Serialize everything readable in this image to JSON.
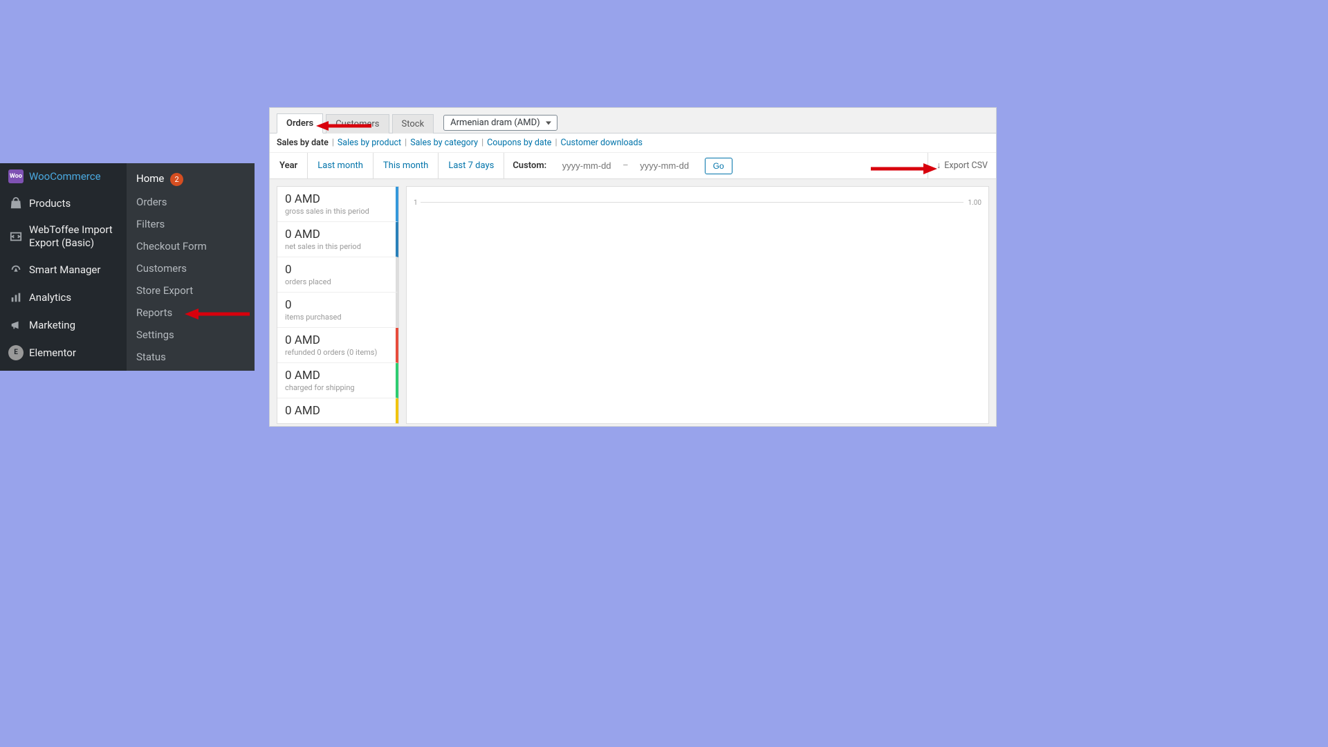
{
  "sidebar": {
    "main": [
      {
        "label": "WooCommerce",
        "icon": "woo"
      },
      {
        "label": "Products",
        "icon": "bag"
      },
      {
        "label": "WebToffee Import Export (Basic)",
        "icon": "import-export"
      },
      {
        "label": "Smart Manager",
        "icon": "gauge"
      },
      {
        "label": "Analytics",
        "icon": "bars"
      },
      {
        "label": "Marketing",
        "icon": "megaphone"
      },
      {
        "label": "Elementor",
        "icon": "elementor"
      }
    ],
    "submenu": {
      "home": {
        "label": "Home",
        "badge": "2"
      },
      "items": [
        {
          "label": "Orders"
        },
        {
          "label": "Filters"
        },
        {
          "label": "Checkout Form"
        },
        {
          "label": "Customers"
        },
        {
          "label": "Store Export"
        },
        {
          "label": "Reports"
        },
        {
          "label": "Settings"
        },
        {
          "label": "Status"
        }
      ]
    }
  },
  "reports": {
    "tabs": [
      {
        "label": "Orders",
        "active": true
      },
      {
        "label": "Customers"
      },
      {
        "label": "Stock"
      }
    ],
    "currency": "Armenian dram (AMD)",
    "sub_filters": {
      "active": "Sales by date",
      "links": [
        "Sales by product",
        "Sales by category",
        "Coupons by date",
        "Customer downloads"
      ]
    },
    "ranges": {
      "items": [
        "Year",
        "Last month",
        "This month",
        "Last 7 days"
      ],
      "active": "Year",
      "custom_label": "Custom:",
      "placeholder": "yyyy-mm-dd",
      "go": "Go"
    },
    "export_label": "Export CSV",
    "stats": [
      {
        "value": "0 AMD",
        "label": "gross sales in this period",
        "color": "c-blue"
      },
      {
        "value": "0 AMD",
        "label": "net sales in this period",
        "color": "c-blue2"
      },
      {
        "value": "0",
        "label": "orders placed",
        "color": "c-gray"
      },
      {
        "value": "0",
        "label": "items purchased",
        "color": "c-gray"
      },
      {
        "value": "0 AMD",
        "label": "refunded 0 orders (0 items)",
        "color": "c-red"
      },
      {
        "value": "0 AMD",
        "label": "charged for shipping",
        "color": "c-green"
      },
      {
        "value": "0 AMD",
        "label": "",
        "color": "c-yellow"
      }
    ],
    "chart": {
      "left_tick": "1",
      "right_tick": "1.00"
    }
  }
}
